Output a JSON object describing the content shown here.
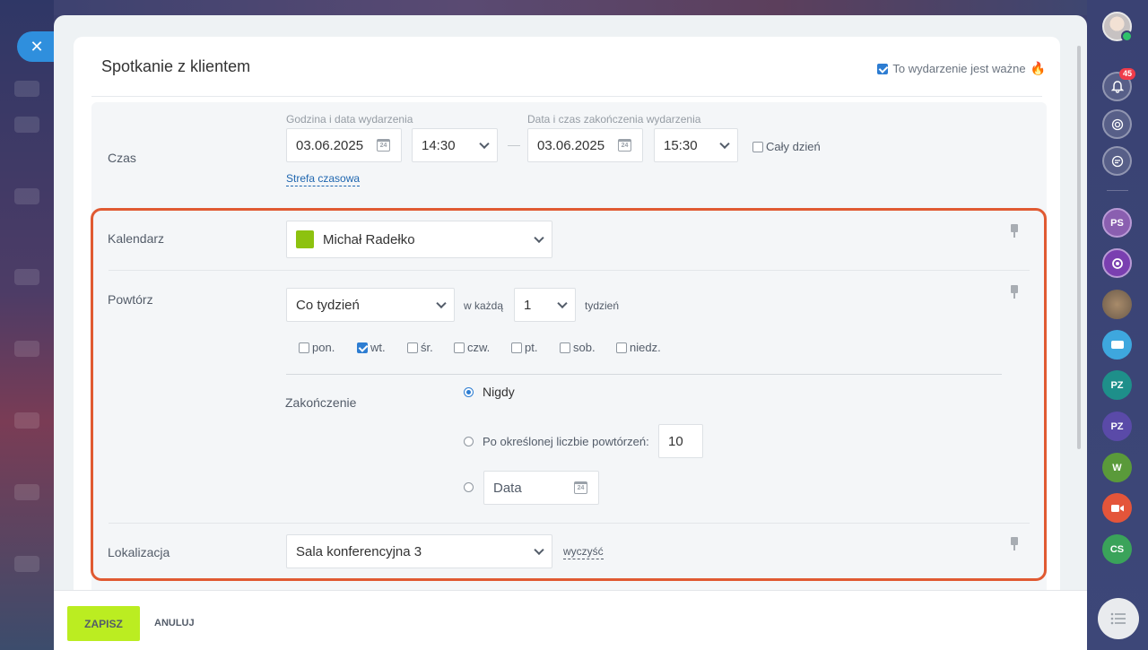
{
  "header": {
    "title": "Spotkanie z klientem",
    "important_label": "To wydarzenie jest ważne"
  },
  "time": {
    "label": "Czas",
    "start_label": "Godzina i data wydarzenia",
    "start_date": "03.06.2025",
    "start_time": "14:30",
    "end_label": "Data i czas zakończenia wydarzenia",
    "end_date": "03.06.2025",
    "end_time": "15:30",
    "all_day_label": "Cały dzień",
    "timezone_link": "Strefa czasowa",
    "calendar_icon_text": "24"
  },
  "calendar": {
    "label": "Kalendarz",
    "value": "Michał Radełko",
    "color": "#8dc20f"
  },
  "repeat": {
    "label": "Powtórz",
    "frequency": "Co tydzień",
    "every_label": "w każdą",
    "interval": "1",
    "unit": "tydzień",
    "days": [
      {
        "label": "pon.",
        "checked": false
      },
      {
        "label": "wt.",
        "checked": true
      },
      {
        "label": "śr.",
        "checked": false
      },
      {
        "label": "czw.",
        "checked": false
      },
      {
        "label": "pt.",
        "checked": false
      },
      {
        "label": "sob.",
        "checked": false
      },
      {
        "label": "niedz.",
        "checked": false
      }
    ],
    "end_label": "Zakończenie",
    "end_options": {
      "never": "Nigdy",
      "count": "Po określonej liczbie powtórzeń:",
      "count_value": "10",
      "date_placeholder": "Data"
    }
  },
  "location": {
    "label": "Lokalizacja",
    "value": "Sala konferencyjna 3",
    "clear": "wyczyść"
  },
  "footer": {
    "save": "ZAPISZ",
    "cancel": "ANULUJ"
  },
  "sidebar": {
    "notification_count": "45",
    "items": [
      "PS",
      "PZ",
      "PZ",
      "W",
      "CS"
    ]
  }
}
